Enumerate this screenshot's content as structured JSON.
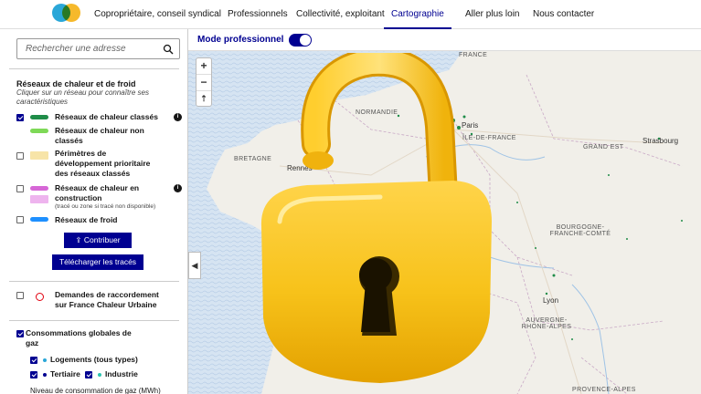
{
  "nav": {
    "items": [
      "Copropriétaire, conseil syndical",
      "Professionnels",
      "Collectivité, exploitant",
      "Cartographie",
      "Aller plus loin",
      "Nous contacter"
    ],
    "active": "Cartographie"
  },
  "search": {
    "placeholder": "Rechercher une adresse"
  },
  "networks": {
    "title": "Réseaux de chaleur et de froid",
    "subtitle": "Cliquer sur un réseau pour connaître ses caractéristiques",
    "items": [
      {
        "label": "Réseaux de chaleur classés",
        "checked": true,
        "color": "#1f8d49"
      },
      {
        "label": "Réseaux de chaleur non classés",
        "checked": false,
        "color": "#7ed957"
      },
      {
        "label": "Périmètres de développement prioritaire des réseaux classés",
        "checked": false,
        "color": "#f7e4a8"
      },
      {
        "label": "Réseaux de chaleur en construction",
        "note": "(tracé ou zone si tracé non disponible)",
        "checked": false,
        "color": "#d667d6"
      },
      {
        "label": "Réseaux de froid",
        "checked": false,
        "color": "#1e90ff"
      }
    ],
    "contribute_button": "Contribuer",
    "download_button": "Télécharger les tracés"
  },
  "requests": {
    "label": "Demandes de raccordement sur France Chaleur Urbaine",
    "checked": false
  },
  "gas": {
    "title": "Consommations globales de gaz",
    "checked": true,
    "items": [
      {
        "label": "Logements (tous types)",
        "checked": true,
        "color": "#2aa7d8"
      },
      {
        "label": "Tertiaire",
        "checked": true,
        "color": "#000091"
      },
      {
        "label": "Industrie",
        "checked": true,
        "color": "#2bc4b0"
      }
    ],
    "level_label": "Niveau de consommation de gaz (MWh)"
  },
  "map": {
    "mode_label": "Mode professionnel",
    "mode_on": true,
    "zoom_in": "+",
    "zoom_out": "−",
    "reset": "⇡",
    "regions": [
      "FRANCE",
      "NORMANDIE",
      "ÎLE-DE-FRANCE",
      "GRAND EST",
      "BRETAGNE",
      "BOURGOGNE-FRANCHE-COMTÉ",
      "AUVERGNE-RHÔNE-ALPES",
      "PROVENCE-ALPES"
    ],
    "cities": [
      "Rennes",
      "Paris",
      "Strasbourg",
      "Lyon"
    ]
  },
  "overlay": {
    "icon": "open-padlock-icon"
  }
}
